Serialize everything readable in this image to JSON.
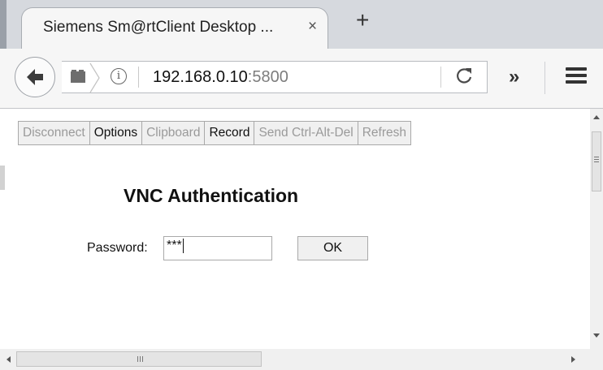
{
  "browser": {
    "tab": {
      "title": "Siemens Sm@rtClient Desktop ...",
      "close_glyph": "×"
    },
    "new_tab_glyph": "+",
    "address": {
      "host": "192.168.0.10",
      "port": ":5800"
    },
    "overflow_glyph": "»",
    "info_glyph": "i",
    "reload_glyph": "C",
    "colors": {
      "tabstrip": "#d6d9de",
      "navbar": "#f6f6f6",
      "url_port": "#7d7d7d"
    }
  },
  "toolbar": {
    "buttons": [
      {
        "label": "Disconnect",
        "enabled": false
      },
      {
        "label": "Options",
        "enabled": true
      },
      {
        "label": "Clipboard",
        "enabled": false
      },
      {
        "label": "Record",
        "enabled": true
      },
      {
        "label": "Send Ctrl-Alt-Del",
        "enabled": false
      },
      {
        "label": "Refresh",
        "enabled": false
      }
    ]
  },
  "auth": {
    "title": "VNC Authentication",
    "password_label": "Password:",
    "password_value": "***",
    "ok_label": "OK"
  },
  "icons": [
    "back-arrow-icon",
    "folder-icon",
    "info-icon",
    "reload-icon",
    "overflow-icon",
    "menu-icon"
  ]
}
